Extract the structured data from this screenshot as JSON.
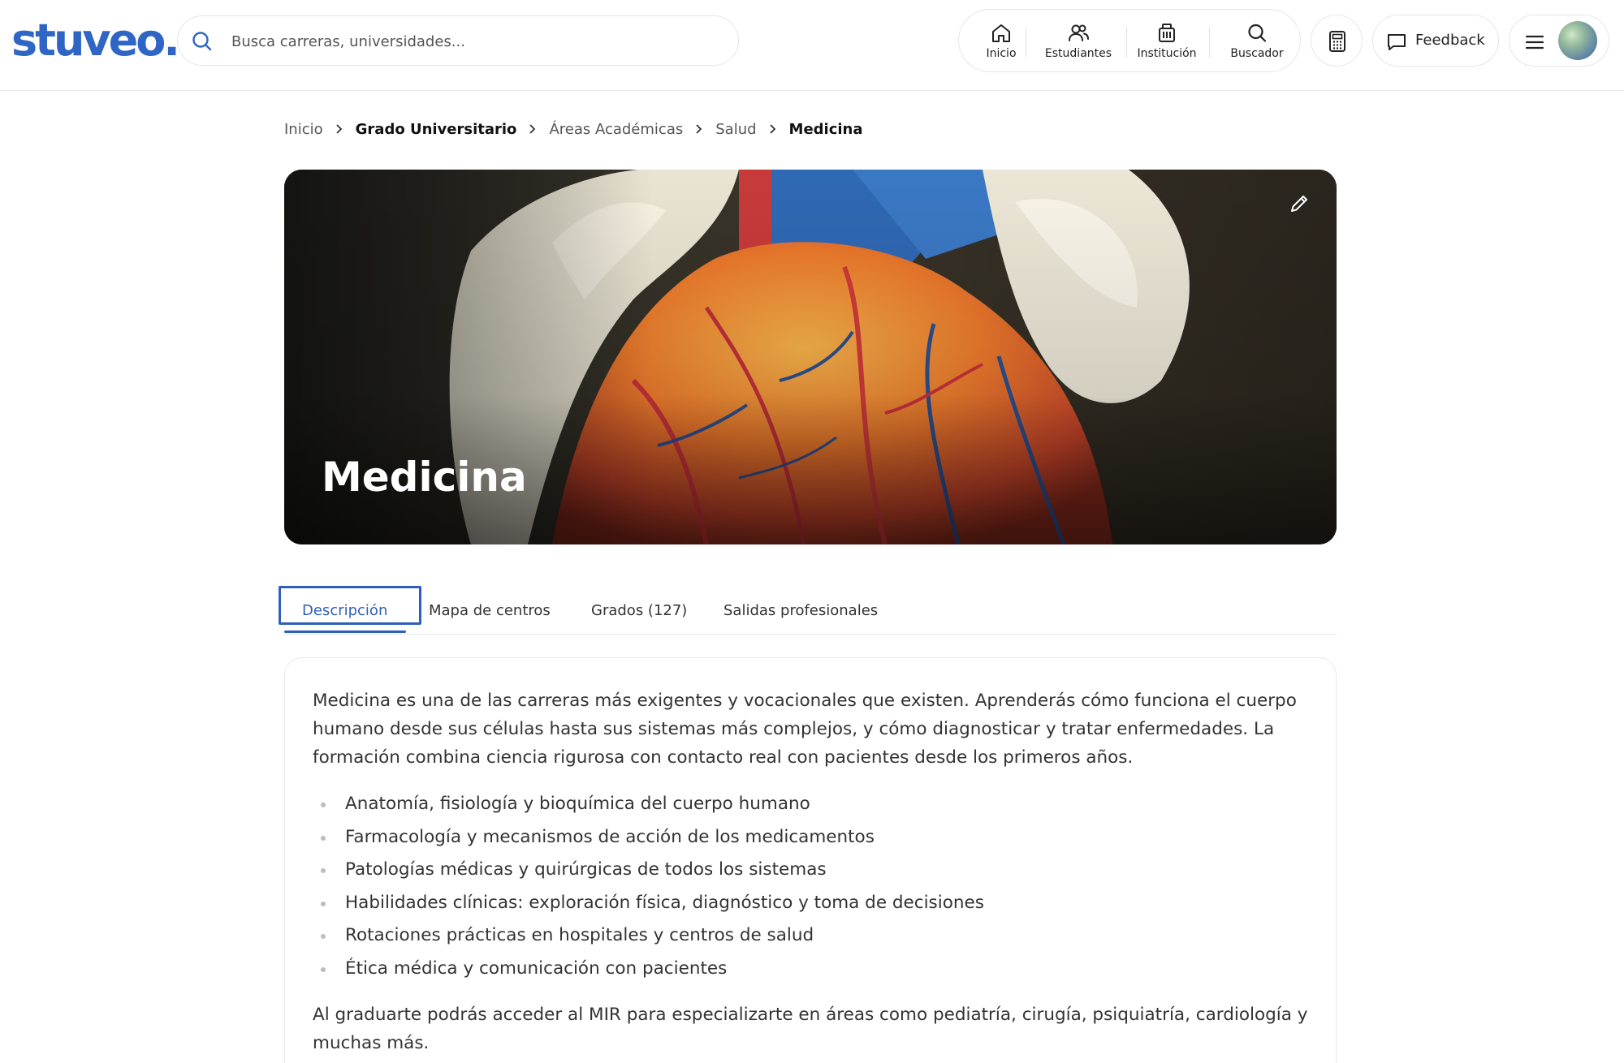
{
  "header": {
    "logo": "stuveo.",
    "search_placeholder": "Busca carreras, universidades...",
    "nav": [
      {
        "label": "Inicio",
        "icon": "home-icon"
      },
      {
        "label": "Estudiantes",
        "icon": "users-icon"
      },
      {
        "label": "Institución",
        "icon": "building-icon"
      },
      {
        "label": "Buscador",
        "icon": "search-icon"
      }
    ],
    "calculator_icon": "calculator-icon",
    "feedback_label": "Feedback",
    "menu_icon": "hamburger-menu-icon"
  },
  "breadcrumb": [
    "Inicio",
    "Grado Universitario",
    "Áreas Académicas",
    "Salud",
    "Medicina"
  ],
  "hero": {
    "title": "Medicina",
    "edit_icon": "pencil-icon"
  },
  "tabs": [
    {
      "label": "Descripción",
      "active": true
    },
    {
      "label": "Mapa de centros",
      "active": false
    },
    {
      "label": "Grados (127)",
      "active": false
    },
    {
      "label": "Salidas profesionales",
      "active": false
    }
  ],
  "content": {
    "intro": "Medicina es una de las carreras más exigentes y vocacionales que existen. Aprenderás cómo funciona el cuerpo humano desde sus células hasta sus sistemas más complejos, y cómo diagnosticar y tratar enfermedades. La formación combina ciencia rigurosa con contacto real con pacientes desde los primeros años.",
    "bullets": [
      "Anatomía, fisiología y bioquímica del cuerpo humano",
      "Farmacología y mecanismos de acción de los medicamentos",
      "Patologías médicas y quirúrgicas de todos los sistemas",
      "Habilidades clínicas: exploración física, diagnóstico y toma de decisiones",
      "Rotaciones prácticas en hospitales y centros de salud",
      "Ética médica y comunicación con pacientes"
    ],
    "outro": "Al graduarte podrás acceder al MIR para especializarte en áreas como pediatría, cirugía, psiquiatría, cardiología y muchas más."
  },
  "colors": {
    "brand": "#2f65c4",
    "active_tab": "#2f5fb8",
    "text": "#333333"
  }
}
